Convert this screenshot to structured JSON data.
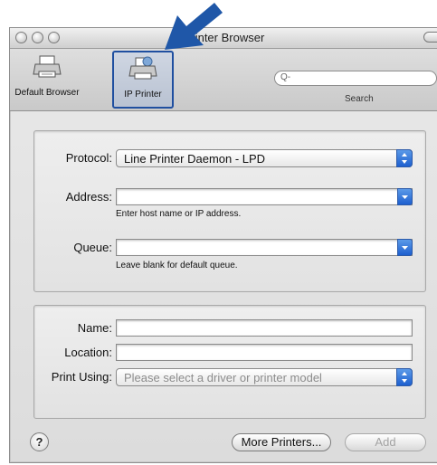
{
  "window": {
    "title": "Printer Browser"
  },
  "toolbar": {
    "items": [
      {
        "label": "Default Browser",
        "icon": "printer-icon"
      },
      {
        "label": "IP Printer",
        "icon": "ip-printer-icon",
        "selected": true
      }
    ],
    "search": {
      "placeholder": "Q-",
      "label": "Search"
    }
  },
  "connection": {
    "protocol_label": "Protocol:",
    "protocol_value": "Line Printer Daemon - LPD",
    "address_label": "Address:",
    "address_value": "",
    "address_hint": "Enter host name or IP address.",
    "queue_label": "Queue:",
    "queue_value": "",
    "queue_hint": "Leave blank for default queue."
  },
  "details": {
    "name_label": "Name:",
    "name_value": "",
    "location_label": "Location:",
    "location_value": "",
    "print_using_label": "Print Using:",
    "print_using_value": "Please select a driver or printer model"
  },
  "footer": {
    "help_label": "?",
    "more_printers_label": "More Printers...",
    "add_label": "Add"
  },
  "colors": {
    "accent_blue": "#1d5fcf",
    "annotation_arrow": "#1f57a8"
  }
}
